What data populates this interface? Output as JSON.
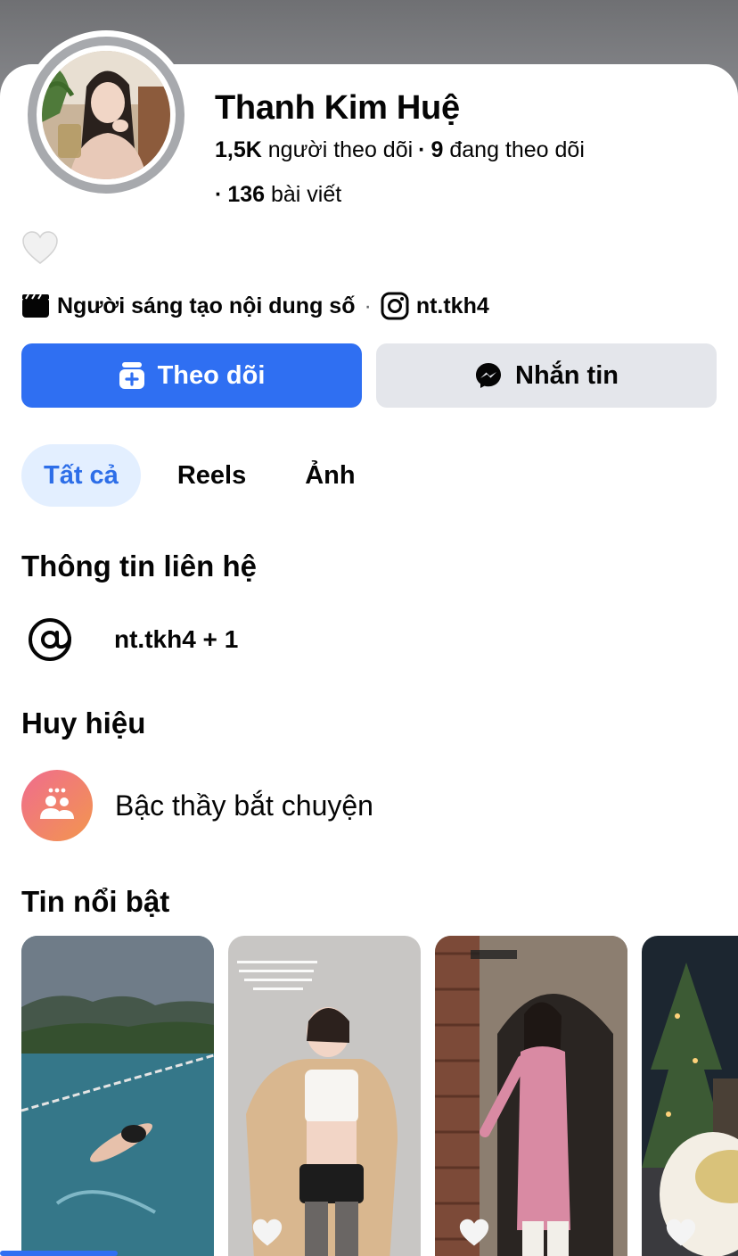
{
  "profile": {
    "name": "Thanh Kim Huệ",
    "followers_count": "1,5K",
    "followers_label": "người theo dõi",
    "following_count": "9",
    "following_label": "đang theo dõi",
    "posts_count": "136",
    "posts_label": "bài viết",
    "bio_icon": "white-heart-icon",
    "category": "Người sáng tạo nội dung số",
    "instagram_handle": "nt.tkh4"
  },
  "actions": {
    "follow_label": "Theo dõi",
    "message_label": "Nhắn tin"
  },
  "tabs": [
    {
      "label": "Tất cả",
      "active": true
    },
    {
      "label": "Reels",
      "active": false
    },
    {
      "label": "Ảnh",
      "active": false
    }
  ],
  "contact": {
    "title": "Thông tin liên hệ",
    "value": "nt.tkh4 + 1"
  },
  "badges": {
    "title": "Huy hiệu",
    "items": [
      {
        "label": "Bậc thầy bắt chuyện",
        "icon": "conversation-starter-icon"
      }
    ]
  },
  "stories": {
    "title": "Tin nổi bật",
    "items": [
      {
        "label": "pool-story"
      },
      {
        "label": "white-top-story"
      },
      {
        "label": "ao-dai-story"
      },
      {
        "label": "night-tree-story"
      }
    ]
  },
  "colors": {
    "primary": "#2f6ff2",
    "tab_active_bg": "#e3efff",
    "secondary_button": "#e4e6eb"
  }
}
